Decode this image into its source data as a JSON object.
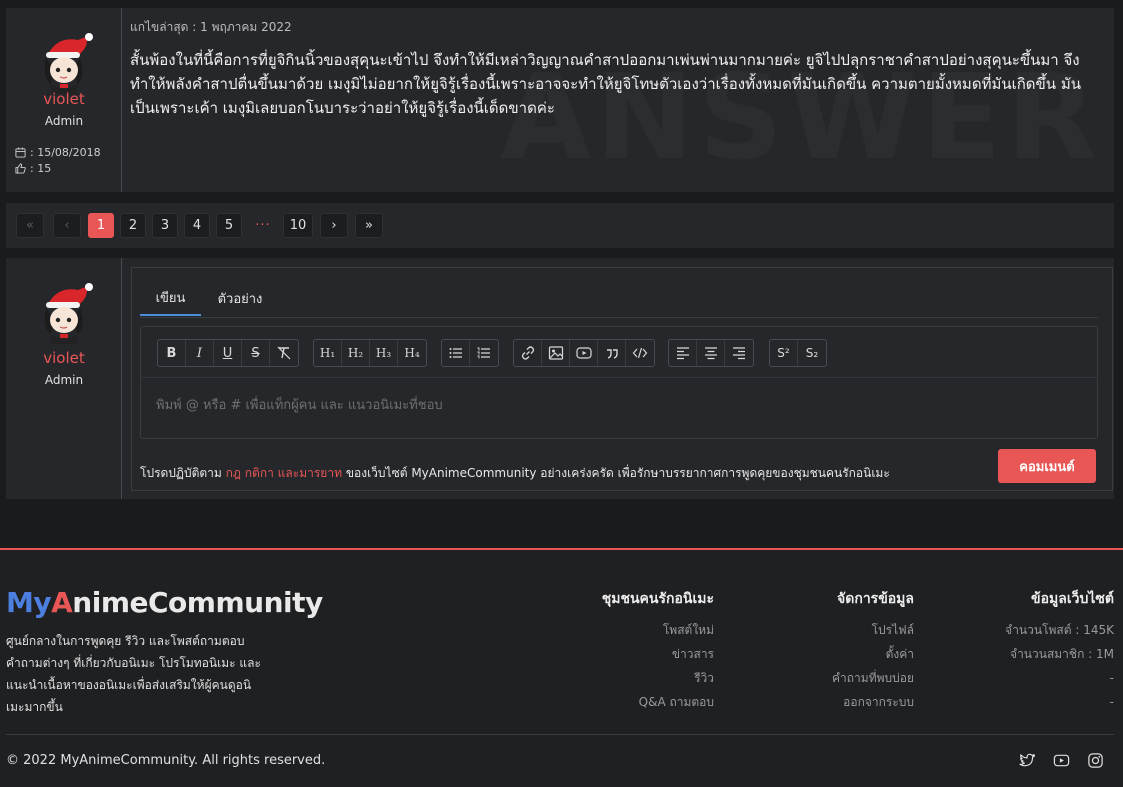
{
  "post": {
    "user_name": "violet",
    "user_role": "Admin",
    "join_date": ": 15/08/2018",
    "likes": ": 15",
    "edited_label": "แกไขล่าสุด : 1 พฤภาคม 2022",
    "body": "สั้นพ้องในที่นี้คือการที่ยูจิกินนิ้วของสุคุนะเข้าไป จึงทำให้มีเหล่าวิญญาณคำสาปออกมาเพ่นพ่านมากมายค่ะ ยูจิไปปลุกราชาคำสาปอย่างสุคุนะขึ้นมา จึงทำให้พลังคำสาปตื่นขึ้นมาด้วย เมงุมิไม่อยากให้ยูจิรู้เรื่องนี้เพราะอาจจะทำให้ยูจิโทษตัวเองว่าเรื่องทั้งหมดที่มันเกิดขึ้น ความตายมั้งหมดที่มันเกิดขึ้น มันเป็นเพราะเค้า เมงุมิเลยบอกโนบาระว่าอย่าให้ยูจิรู้เรื่องนี้เด็ดขาดค่ะ",
    "watermark": "ANSWER"
  },
  "pagination": {
    "first": "«",
    "prev": "‹",
    "pages": [
      "1",
      "2",
      "3",
      "4",
      "5"
    ],
    "ellipsis": "···",
    "last_page": "10",
    "next": "›",
    "last": "»"
  },
  "editor": {
    "user_name": "violet",
    "user_role": "Admin",
    "tab_write": "เขียน",
    "tab_preview": "ตัวอย่าง",
    "placeholder": "พิมพ์ @ หรือ # เพื่อแท็กผู้คน และ แนวอนิเมะที่ชอบ",
    "rules_prefix": "โปรดปฏิบัติตาม",
    "rules_link": "กฎ กติกา และมารยาท",
    "rules_suffix": "ของเว็บไซต์ MyAnimeCommunity อย่างเคร่งครัด เพื่อรักษาบรรยากาศการพูดคุยของชุมชนคนรักอนิเมะ",
    "submit": "คอมเมนต์",
    "toolbar": {
      "bold": "B",
      "italic": "I",
      "underline": "U",
      "strike": "S",
      "h1": "H₁",
      "h2": "H₂",
      "h3": "H₃",
      "h4": "H₄",
      "sup": "S²",
      "sub": "S₂"
    }
  },
  "footer": {
    "logo_my": "My",
    "logo_a": "A",
    "logo_rest": "nimeCommunity",
    "about": "ศูนย์กลางในการพูดคุย รีวิว และโพสต์ถามตอบคำถามต่างๆ ที่เกี่ยวกับอนิเมะ โปรโมทอนิเมะ และแนะนำเนื้อหาของอนิเมะเพื่อส่งเสริมให้ผู้คนดูอนิเมะมากขึ้น",
    "col1": {
      "title": "ชุมชนคนรักอนิเมะ",
      "items": [
        "โพสต์ใหม่",
        "ข่าวสาร",
        "รีวิว",
        "Q&A ถามตอบ"
      ]
    },
    "col2": {
      "title": "จัดการข้อมูล",
      "items": [
        "โปรไฟล์",
        "ตั้งค่า",
        "คำถามที่พบบ่อย",
        "ออกจากระบบ"
      ]
    },
    "col3": {
      "title": "ข้อมูลเว็บไซต์",
      "items": [
        "จำนวนโพสต์ : 145K",
        "จำนวนสมาชิก : 1M",
        "-",
        "-"
      ]
    },
    "copyright": "© 2022 MyAnimeCommunity. All rights reserved."
  },
  "colors": {
    "accent": "#e85656",
    "brand_blue": "#4d7fe0",
    "tab_active": "#4d8fd6"
  }
}
